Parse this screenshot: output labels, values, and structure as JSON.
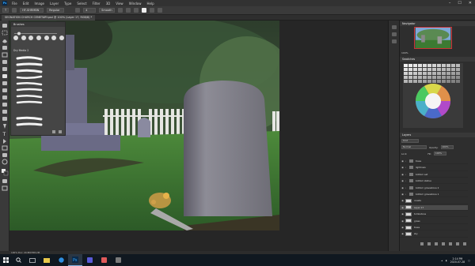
{
  "menu": {
    "items": [
      "File",
      "Edit",
      "Image",
      "Layer",
      "Type",
      "Select",
      "Filter",
      "3D",
      "View",
      "Window",
      "Help"
    ]
  },
  "options": {
    "tool_preset": "T",
    "font": "HF-SHRMBN",
    "style": "Regular",
    "size": "4",
    "antialias": "Smooth"
  },
  "document": {
    "tab_title": "SEGNATION CHURCH CEMETARY.psd @ 100% (Layer 17, RGB/8) *"
  },
  "brushes_panel": {
    "title": "Brushes",
    "folder_label": "Dry Media 2",
    "tips_count": 7
  },
  "navigator": {
    "title": "Navigator",
    "zoom": "100%"
  },
  "swatches_panel": {
    "title": "Swatches"
  },
  "layers_panel": {
    "title": "Layers",
    "filter_label": "Kind",
    "blend_mode": "Normal",
    "opacity_label": "Opacity:",
    "opacity_value": "100%",
    "lock_label": "Lock:",
    "fill_label": "Fill:",
    "fill_value": "100%",
    "layers": [
      {
        "name": "trees",
        "type": "folder",
        "visible": true,
        "selected": false
      },
      {
        "name": "lightrows",
        "type": "folder",
        "visible": true,
        "selected": false
      },
      {
        "name": "bottom set",
        "type": "folder",
        "visible": true,
        "selected": false
      },
      {
        "name": "bottom statue",
        "type": "folder",
        "visible": true,
        "selected": false
      },
      {
        "name": "bottom gravestone 2",
        "type": "folder",
        "visible": true,
        "selected": false
      },
      {
        "name": "bottom gravestone 1",
        "type": "folder",
        "visible": true,
        "selected": false
      },
      {
        "name": "coasts",
        "type": "layer",
        "visible": true,
        "selected": false
      },
      {
        "name": "Layer 17",
        "type": "layer",
        "visible": true,
        "selected": true
      },
      {
        "name": "tombstone",
        "type": "layer",
        "visible": true,
        "selected": false
      },
      {
        "name": "grass",
        "type": "layer",
        "visible": true,
        "selected": false
      },
      {
        "name": "trees",
        "type": "layer",
        "visible": true,
        "selected": false
      },
      {
        "name": "sky",
        "type": "layer",
        "visible": true,
        "selected": false
      }
    ]
  },
  "status": {
    "text": "100%    Doc: 20.8M/358.2M"
  },
  "taskbar": {
    "time": "2:14 PM",
    "date": "2020-07-28"
  },
  "colors": {
    "ps_blue": "#31a8ff",
    "panel_bg": "#454545",
    "sky_green": "#2e4a2c",
    "grass": "#3f7d35",
    "tombstone": "#8e8e94"
  }
}
